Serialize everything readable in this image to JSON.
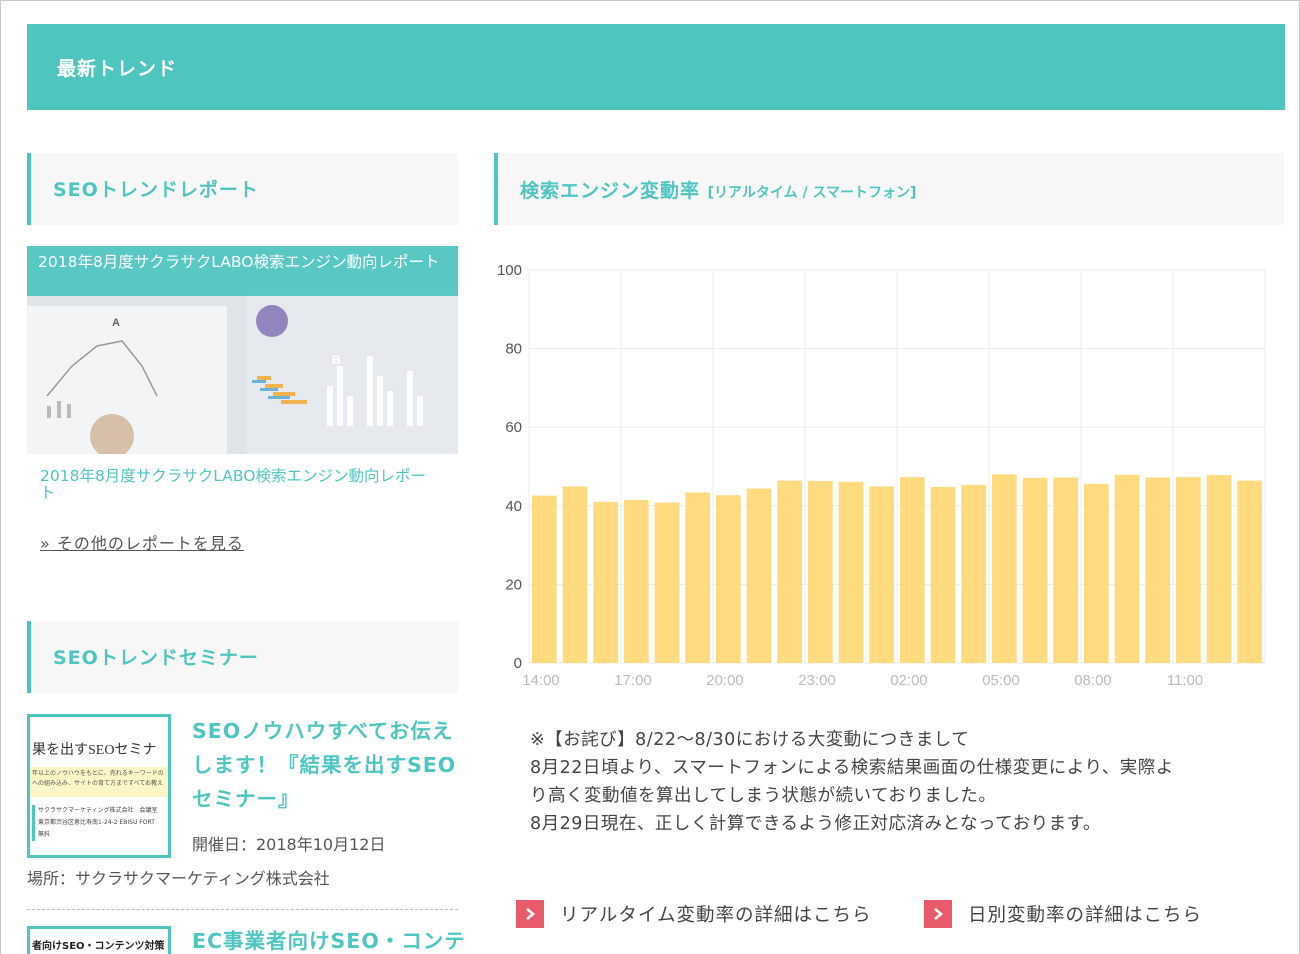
{
  "banner": {
    "title": "最新トレンド"
  },
  "report_section": {
    "title": "SEOトレンドレポート",
    "card_caption": "2018年8月度サクラサクLABO検索エンジン動向レポート",
    "card_link": "2018年8月度サクラサクLABO検索エンジン動向レポート",
    "more_link": "» その他のレポートを見る"
  },
  "seminar_section": {
    "title": "SEOトレンドセミナー",
    "items": [
      {
        "title": "SEOノウハウすべてお伝えします！『結果を出すSEOセミナー』",
        "date": "開催日：2018年10月12日",
        "place": "場所：サクラサクマーケティング株式会社",
        "thumb_title": "果を出すSEOセミナ",
        "thumb_lines": [
          "年以上のノウハウをもとに、売れるキーワードの",
          "への組み込み、サイトの育て方まですべてお教え",
          "サクラサクマーケティング株式会社　会議室",
          "東京都渋谷区恵比寿南1-24-2 EBISU FORT",
          "無料"
        ]
      },
      {
        "title": "EC事業者向けSEO・コンテ",
        "thumb_title": "者向けSEO・コンテンツ対策"
      }
    ]
  },
  "chart_section": {
    "title": "検索エンジン変動率",
    "subtitle": "[リアルタイム / スマートフォン]"
  },
  "chart_data": {
    "type": "bar",
    "ylim": [
      0,
      100
    ],
    "y_ticks": [
      "0",
      "20",
      "40",
      "60",
      "80",
      "100"
    ],
    "x_tick_labels": [
      "14:00",
      "17:00",
      "20:00",
      "23:00",
      "02:00",
      "05:00",
      "08:00",
      "11:00"
    ],
    "values": [
      42.6,
      44.9,
      41.0,
      41.5,
      40.8,
      43.4,
      42.7,
      44.4,
      46.4,
      46.3,
      46.1,
      44.9,
      47.3,
      44.8,
      45.3,
      48.0,
      47.1,
      47.2,
      45.6,
      47.9,
      47.2,
      47.3,
      47.8,
      46.4
    ],
    "bar_color": "#ffd877",
    "grid": true,
    "legend": "none"
  },
  "notice": {
    "lines": [
      "※【お詫び】8/22〜8/30における大変動につきまして",
      "8月22日頃より、スマートフォンによる検索結果画面の仕様変更により、実際よ",
      "り高く変動値を算出してしまう状態が続いておりました。",
      "8月29日現在、正しく計算できるよう修正対応済みとなっております。"
    ]
  },
  "links": {
    "realtime": "リアルタイム変動率の詳細はこちら",
    "daily": "日別変動率の詳細はこちら"
  },
  "colors": {
    "accent": "#4fc5c0",
    "bar": "#ffd877",
    "cta": "#e85b6b"
  }
}
